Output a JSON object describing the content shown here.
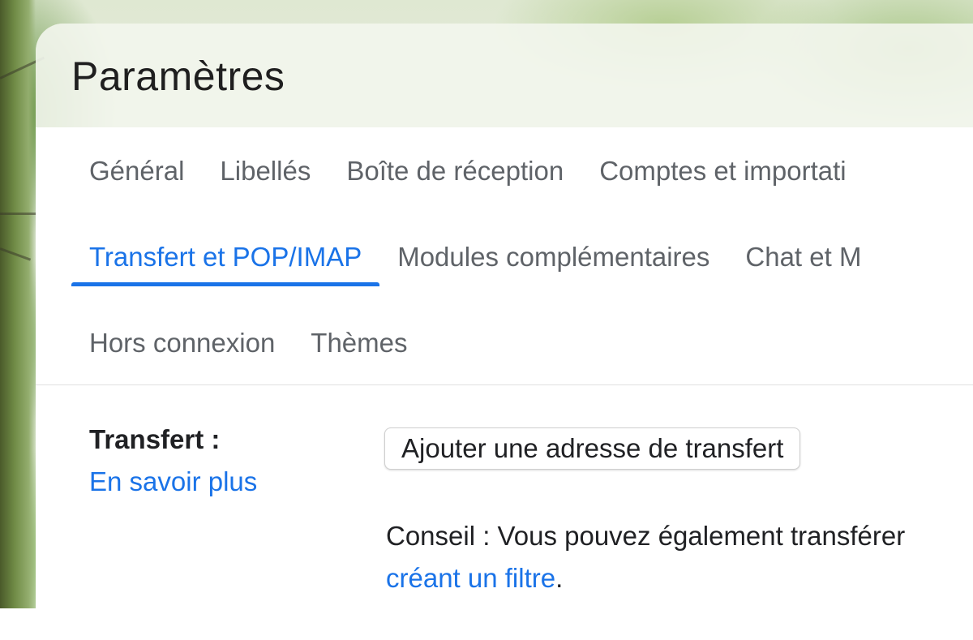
{
  "settings": {
    "title": "Paramètres"
  },
  "tabs": {
    "row1": [
      "Général",
      "Libellés",
      "Boîte de réception",
      "Comptes et importati"
    ],
    "row2": [
      "Transfert et POP/IMAP",
      "Modules complémentaires",
      "Chat et M"
    ],
    "row3": [
      "Hors connexion",
      "Thèmes"
    ],
    "active": "Transfert et POP/IMAP"
  },
  "forwarding": {
    "label": "Transfert :",
    "learn_more": "En savoir plus",
    "add_button": "Ajouter une adresse de transfert",
    "tip_line1": "Conseil : Vous pouvez également transférer",
    "tip_link": "créant un filtre",
    "tip_end": "."
  },
  "colors": {
    "accent": "#1a73e8",
    "tab_text": "#5f6368",
    "text": "#202124"
  }
}
